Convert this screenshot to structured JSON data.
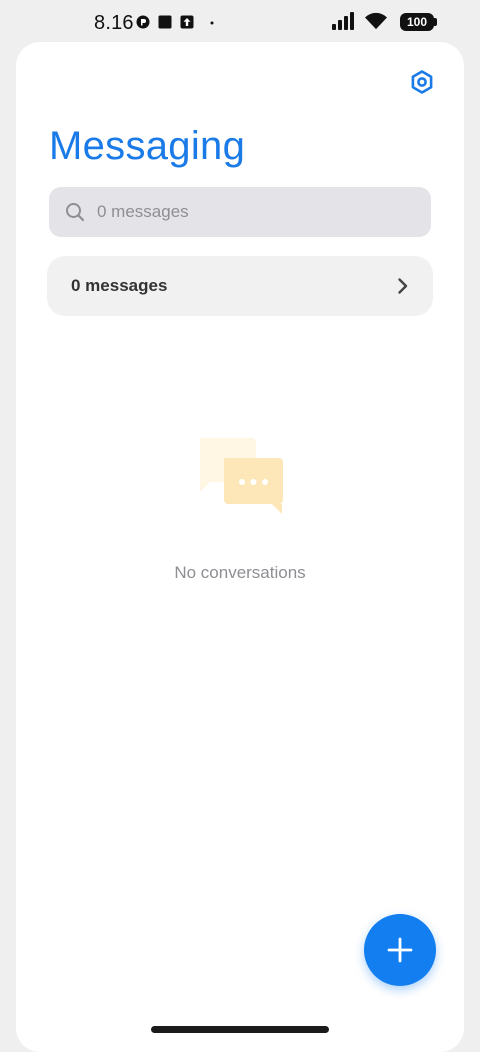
{
  "status_bar": {
    "time": "8.16",
    "battery": "100",
    "icons": [
      "notification-icon",
      "square-icon",
      "upload-icon",
      "dot-icon",
      "signal-icon",
      "wifi-icon",
      "battery-icon"
    ]
  },
  "header": {
    "title": "Messaging",
    "settings_icon": "settings-icon"
  },
  "search": {
    "placeholder": "0 messages",
    "icon": "search-icon"
  },
  "messages_row": {
    "label": "0 messages",
    "icon": "chevron-right-icon"
  },
  "empty_state": {
    "text": "No conversations",
    "icon": "chat-bubbles-icon"
  },
  "fab": {
    "icon": "plus-icon"
  },
  "colors": {
    "accent": "#1a7be8",
    "fab": "#127ef0",
    "search_bg": "#e3e3e8",
    "row_bg": "#f1f1f1",
    "illustration": "#fde6b8"
  }
}
